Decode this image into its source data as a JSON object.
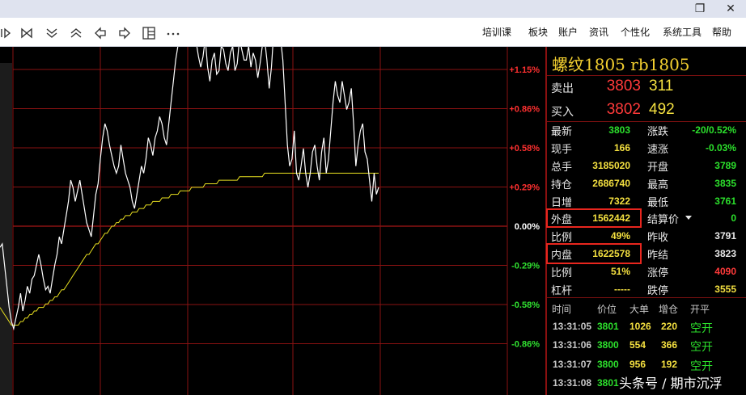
{
  "window": {
    "restore_glyph": "❐",
    "close_glyph": "✕"
  },
  "toolbar": {
    "menus": [
      "培训课",
      "板块",
      "账户",
      "资讯",
      "个性化",
      "系统工具",
      "帮助"
    ]
  },
  "chart": {
    "pct_labels": [
      "+1.15%",
      "+0.86%",
      "+0.58%",
      "+0.29%",
      "0.00%",
      "-0.29%",
      "-0.58%",
      "-0.86%"
    ],
    "colors": {
      "up": "#ff3030",
      "zero": "#ffffff",
      "down": "#30e030",
      "grid": "#8a1212",
      "price": "#ffffff",
      "avg": "#e8e020"
    },
    "price_series": [
      3817,
      3818,
      3812,
      3806,
      3800,
      3796,
      3794,
      3797,
      3800,
      3804,
      3799,
      3802,
      3806,
      3804,
      3808,
      3809,
      3812,
      3815,
      3812,
      3808,
      3805,
      3806,
      3804,
      3808,
      3812,
      3815,
      3820,
      3818,
      3822,
      3826,
      3830,
      3836,
      3834,
      3830,
      3833,
      3836,
      3832,
      3828,
      3824,
      3822,
      3820,
      3826,
      3832,
      3835,
      3842,
      3848,
      3852,
      3850,
      3846,
      3843,
      3840,
      3838,
      3840,
      3846,
      3842,
      3838,
      3836,
      3834,
      3830,
      3828,
      3832,
      3836,
      3840,
      3838,
      3842,
      3848,
      3846,
      3843,
      3848,
      3850,
      3854,
      3852,
      3848,
      3846,
      3852,
      3858,
      3864,
      3870,
      3874,
      3879,
      3884,
      3885,
      3880,
      3878,
      3883,
      3880,
      3875,
      3871,
      3868,
      3871,
      3876,
      3868,
      3864,
      3870,
      3872,
      3866,
      3867,
      3874,
      3873,
      3869,
      3867,
      3872,
      3874,
      3867,
      3869,
      3876,
      3873,
      3870,
      3870,
      3874,
      3868,
      3872,
      3870,
      3865,
      3869,
      3874,
      3876,
      3870,
      3862,
      3868,
      3878,
      3884,
      3882,
      3876,
      3870,
      3858,
      3846,
      3840,
      3842,
      3850,
      3838,
      3836,
      3840,
      3845,
      3838,
      3834,
      3838,
      3844,
      3846,
      3840,
      3836,
      3844,
      3848,
      3838,
      3842,
      3850,
      3858,
      3864,
      3860,
      3858,
      3864,
      3860,
      3856,
      3858,
      3862,
      3852,
      3840,
      3846,
      3850,
      3852,
      3844,
      3842,
      3836,
      3830,
      3838,
      3832,
      3834
    ],
    "avg_series": [
      3800,
      3799,
      3798,
      3797,
      3796,
      3795,
      3795,
      3795,
      3795,
      3796,
      3796,
      3797,
      3797,
      3798,
      3798,
      3799,
      3799,
      3800,
      3800,
      3800,
      3801,
      3801,
      3802,
      3802,
      3803,
      3803,
      3804,
      3805,
      3805,
      3806,
      3807,
      3808,
      3809,
      3810,
      3811,
      3812,
      3813,
      3814,
      3815,
      3815,
      3816,
      3817,
      3818,
      3818,
      3819,
      3820,
      3821,
      3821,
      3822,
      3823,
      3823,
      3824,
      3824,
      3825,
      3825,
      3826,
      3826,
      3826,
      3827,
      3827,
      3827,
      3828,
      3828,
      3828,
      3829,
      3829,
      3829,
      3830,
      3830,
      3830,
      3830,
      3831,
      3831,
      3831,
      3831,
      3832,
      3832,
      3832,
      3832,
      3833,
      3833,
      3833,
      3833,
      3833,
      3834,
      3834,
      3834,
      3834,
      3834,
      3834,
      3835,
      3835,
      3835,
      3835,
      3835,
      3835,
      3836,
      3836,
      3836,
      3836,
      3836,
      3836,
      3836,
      3836,
      3836,
      3837,
      3837,
      3837,
      3837,
      3837,
      3837,
      3837,
      3837,
      3837,
      3837,
      3837,
      3838,
      3838,
      3838,
      3838,
      3838,
      3838,
      3838,
      3838,
      3838,
      3838,
      3838,
      3838,
      3838,
      3838,
      3838,
      3838,
      3838,
      3838,
      3838,
      3838,
      3838,
      3838,
      3838,
      3838,
      3838,
      3838,
      3838,
      3838,
      3838,
      3838,
      3838,
      3838,
      3838,
      3838,
      3838,
      3838,
      3838,
      3838,
      3838,
      3838,
      3838,
      3838,
      3838,
      3838,
      3838,
      3838,
      3838,
      3838,
      3838,
      3838,
      3838
    ]
  },
  "quote": {
    "title": "螺纹1805  rb1805",
    "sell": {
      "label": "卖出",
      "price": "3803",
      "vol": "311"
    },
    "buy": {
      "label": "买入",
      "price": "3802",
      "vol": "492"
    },
    "rows": [
      {
        "l1": "最新",
        "v1": "3803",
        "c1": "green",
        "l2": "涨跌",
        "v2": "-20/0.52%",
        "c2": "green"
      },
      {
        "l1": "现手",
        "v1": "166",
        "c1": "yellow",
        "l2": "速涨",
        "v2": "-0.03%",
        "c2": "green"
      },
      {
        "l1": "总手",
        "v1": "3185020",
        "c1": "yellow",
        "l2": "开盘",
        "v2": "3789",
        "c2": "green"
      },
      {
        "l1": "持仓",
        "v1": "2686740",
        "c1": "yellow",
        "l2": "最高",
        "v2": "3835",
        "c2": "green"
      },
      {
        "l1": "日增",
        "v1": "7322",
        "c1": "yellow",
        "l2": "最低",
        "v2": "3761",
        "c2": "green"
      },
      {
        "l1": "外盘",
        "v1": "1562442",
        "c1": "yellow",
        "l2": "结算价",
        "v2": "0",
        "c2": "green"
      },
      {
        "l1": "比例",
        "v1": "49%",
        "c1": "yellow",
        "l2": "昨收",
        "v2": "3791",
        "c2": "white"
      },
      {
        "l1": "内盘",
        "v1": "1622578",
        "c1": "yellow",
        "l2": "昨结",
        "v2": "3823",
        "c2": "white"
      },
      {
        "l1": "比例",
        "v1": "51%",
        "c1": "yellow",
        "l2": "涨停",
        "v2": "4090",
        "c2": "red"
      },
      {
        "l1": "杠杆",
        "v1": "-----",
        "c1": "yellow",
        "l2": "跌停",
        "v2": "3555",
        "c2": "yellow"
      }
    ],
    "ticks_header": [
      "时间",
      "价位",
      "大单",
      "增仓",
      "开平"
    ],
    "ticks": [
      {
        "time": "13:31:05",
        "price": "3801",
        "vol": "1026",
        "oi": "220",
        "type": "空开"
      },
      {
        "time": "13:31:06",
        "price": "3800",
        "vol": "554",
        "oi": "366",
        "type": "空开"
      },
      {
        "time": "13:31:07",
        "price": "3800",
        "vol": "956",
        "oi": "192",
        "type": "空开"
      },
      {
        "time": "13:31:08",
        "price": "3801",
        "vol": "",
        "oi": "",
        "type": ""
      }
    ]
  },
  "watermark": "头条号 / 期市沉浮"
}
